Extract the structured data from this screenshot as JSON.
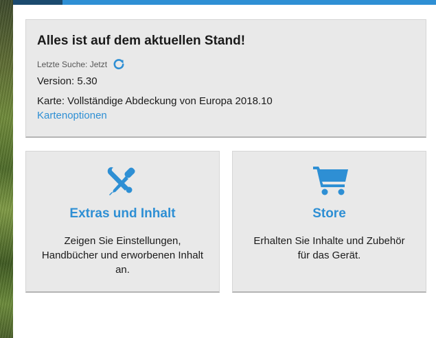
{
  "status": {
    "title": "Alles ist auf dem aktuellen Stand!",
    "last_check": "Letzte Suche: Jetzt",
    "version": "Version: 5.30",
    "map": "Karte: Vollständige Abdeckung von Europa 2018.10",
    "map_options_link": "Kartenoptionen"
  },
  "cards": {
    "extras": {
      "title": "Extras und Inhalt",
      "description": "Zeigen Sie Einstellungen, Handbücher und erworbenen Inhalt an.",
      "icon": "tools-icon"
    },
    "store": {
      "title": "Store",
      "description": "Erhalten Sie Inhalte und Zubehör für das Gerät.",
      "icon": "cart-icon"
    }
  },
  "colors": {
    "accent": "#2e8fd4",
    "topbar_dark": "#1b4a6e",
    "panel_bg": "#e9e9e9"
  }
}
